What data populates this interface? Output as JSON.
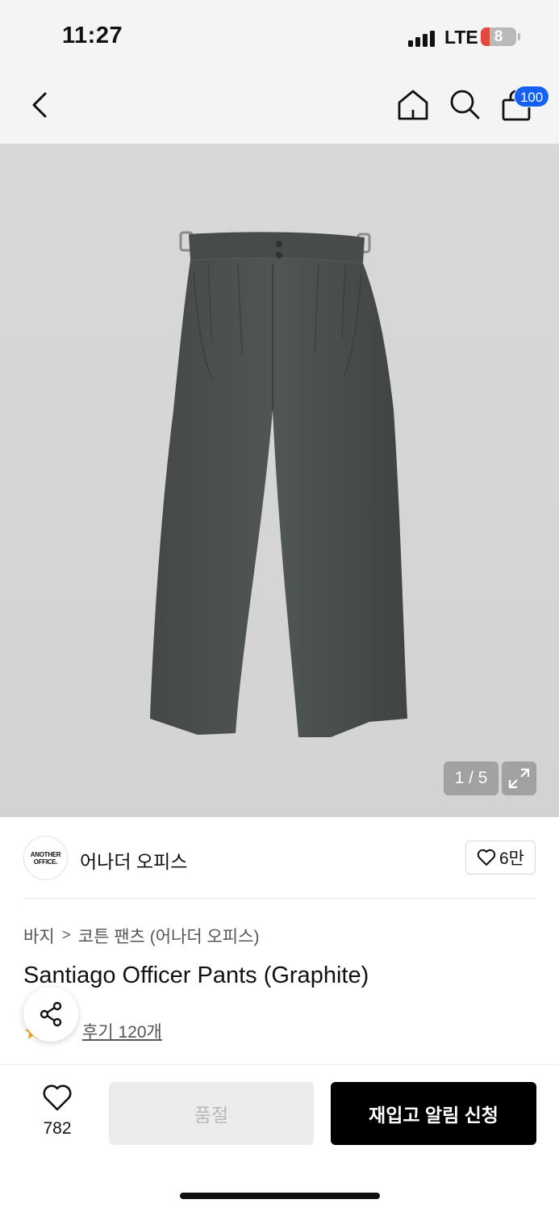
{
  "status_bar": {
    "time": "11:27",
    "network": "LTE",
    "battery_level": "8",
    "battery_fraction": 0.08
  },
  "nav": {
    "back_icon": "chevron-left-icon",
    "home_icon": "home-icon",
    "search_icon": "search-icon",
    "cart_icon": "shopping-bag-icon",
    "cart_count": "100"
  },
  "gallery": {
    "counter": "1 / 5",
    "current_index": 1,
    "total": 5,
    "expand_icon": "expand-icon",
    "product_color": "#4a4f4d"
  },
  "brand": {
    "logo_line1": "ANOTHER",
    "logo_line2": "OFFICE.",
    "name": "어나더 오피스",
    "like_count": "6만"
  },
  "product": {
    "breadcrumb": [
      "바지",
      "코튼 팬츠 (어나더 오피스)"
    ],
    "title": "Santiago Officer Pants (Graphite)",
    "review_link": "후기 120개"
  },
  "bottom_bar": {
    "wish_count": "782",
    "soldout_label": "품절",
    "notify_label": "재입고 알림 신청"
  },
  "colors": {
    "accent_blue": "#1560f5",
    "black_button": "#000000",
    "star": "#f5a623"
  }
}
